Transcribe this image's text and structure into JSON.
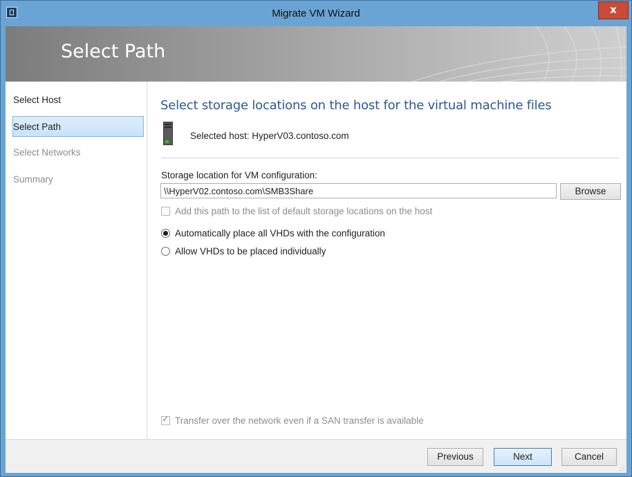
{
  "window": {
    "title": "Migrate VM Wizard",
    "close_label": "x"
  },
  "banner": {
    "title": "Select Path"
  },
  "nav": {
    "items": [
      {
        "label": "Select Host",
        "state": "normal"
      },
      {
        "label": "Select Path",
        "state": "selected"
      },
      {
        "label": "Select Networks",
        "state": "disabled"
      },
      {
        "label": "Summary",
        "state": "disabled"
      }
    ]
  },
  "main": {
    "heading": "Select storage locations on the host for the virtual machine files",
    "host_text": "Selected host:  HyperV03.contoso.com",
    "storage_label": "Storage location for VM configuration:",
    "storage_value": "\\\\HyperV02.contoso.com\\SMB3Share",
    "browse_label": "Browse",
    "add_default_label": "Add this path to the list of default storage locations on the host",
    "radio_auto_label": "Automatically place all VHDs with the configuration",
    "radio_individual_label": "Allow VHDs to be placed individually",
    "transfer_label": "Transfer over the network even if a SAN transfer is available"
  },
  "footer": {
    "previous_label": "Previous",
    "next_label": "Next",
    "cancel_label": "Cancel"
  },
  "colors": {
    "accent": "#2b579a",
    "titlebar": "#6aa4d4",
    "close": "#c84a37"
  }
}
